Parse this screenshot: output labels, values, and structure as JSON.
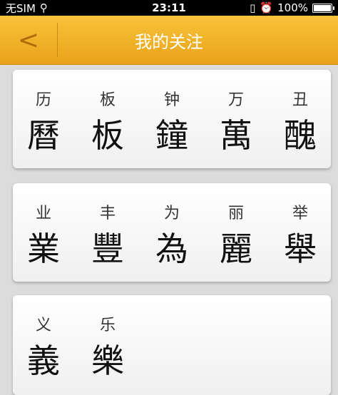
{
  "status_bar": {
    "carrier": "无SIM",
    "time": "23:11",
    "battery": "100%"
  },
  "nav": {
    "back_label": "<",
    "title": "我的关注"
  },
  "cards": [
    [
      {
        "simplified": "历",
        "traditional": "曆"
      },
      {
        "simplified": "板",
        "traditional": "板"
      },
      {
        "simplified": "钟",
        "traditional": "鐘"
      },
      {
        "simplified": "万",
        "traditional": "萬"
      },
      {
        "simplified": "丑",
        "traditional": "醜"
      }
    ],
    [
      {
        "simplified": "业",
        "traditional": "業"
      },
      {
        "simplified": "丰",
        "traditional": "豐"
      },
      {
        "simplified": "为",
        "traditional": "為"
      },
      {
        "simplified": "丽",
        "traditional": "麗"
      },
      {
        "simplified": "举",
        "traditional": "舉"
      }
    ],
    [
      {
        "simplified": "义",
        "traditional": "義"
      },
      {
        "simplified": "乐",
        "traditional": "樂"
      }
    ]
  ]
}
